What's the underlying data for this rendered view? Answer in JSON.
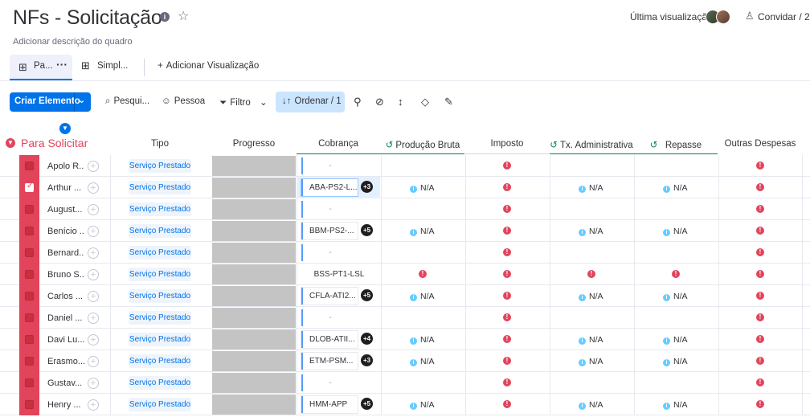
{
  "board": {
    "title": "NFs - Solicitação",
    "description": "Adicionar descrição do quadro",
    "last_view_label": "Última visualização",
    "invite_label": "Convidar / 2"
  },
  "views": {
    "tabs": [
      {
        "label": "Pa...",
        "icon": "table-icon",
        "active": true
      },
      {
        "label": "Simpl...",
        "icon": "table-icon",
        "active": false
      }
    ],
    "add_view_label": "Adicionar Visualização"
  },
  "toolbar": {
    "new_item_label": "Criar Elemento",
    "search_label": "Pesqui...",
    "person_label": "Pessoa",
    "filter_label": "Filtro",
    "sort_label": "Ordenar / 1"
  },
  "group": {
    "title": "Para Solicitar",
    "color": "#e2445c"
  },
  "columns": {
    "tipo": "Tipo",
    "progresso": "Progresso",
    "cobranca": "Cobrança",
    "producao": "Produção Bruta",
    "imposto": "Imposto",
    "tx_admin": "Tx. Administrativa",
    "repasse": "Repasse",
    "outras": "Outras Despesas"
  },
  "rows": [
    {
      "name": "Apolo R...",
      "checked": false,
      "tipo": "Serviço Prestado",
      "cobranca": "-",
      "cob_style": "dash",
      "badge": "",
      "producao": "",
      "imposto": "!",
      "tx_admin": "",
      "repasse": "",
      "outras": "!"
    },
    {
      "name": "Arthur ...",
      "checked": true,
      "tipo": "Serviço Prestado",
      "cobranca": "ABA-PS2-L...",
      "cob_style": "active",
      "badge": "+3",
      "producao": "N/A",
      "imposto": "!",
      "tx_admin": "N/A",
      "repasse": "N/A",
      "outras": "!"
    },
    {
      "name": "August...",
      "checked": false,
      "tipo": "Serviço Prestado",
      "cobranca": "-",
      "cob_style": "dash",
      "badge": "",
      "producao": "",
      "imposto": "!",
      "tx_admin": "",
      "repasse": "",
      "outras": "!"
    },
    {
      "name": "Benício ...",
      "checked": false,
      "tipo": "Serviço Prestado",
      "cobranca": "BBM-PS2-...",
      "cob_style": "normal",
      "badge": "+5",
      "producao": "N/A",
      "imposto": "!",
      "tx_admin": "N/A",
      "repasse": "N/A",
      "outras": "!"
    },
    {
      "name": "Bernard...",
      "checked": false,
      "tipo": "Serviço Prestado",
      "cobranca": "-",
      "cob_style": "dash",
      "badge": "",
      "producao": "",
      "imposto": "!",
      "tx_admin": "",
      "repasse": "",
      "outras": "!"
    },
    {
      "name": "Bruno S...",
      "checked": false,
      "tipo": "Serviço Prestado",
      "cobranca": "BSS-PT1-LSL",
      "cob_style": "plain",
      "badge": "",
      "producao": "!",
      "imposto": "!",
      "tx_admin": "!",
      "repasse": "!",
      "outras": "!"
    },
    {
      "name": "Carlos ...",
      "checked": false,
      "tipo": "Serviço Prestado",
      "cobranca": "CFLA-ATI2...",
      "cob_style": "normal",
      "badge": "+5",
      "producao": "N/A",
      "imposto": "!",
      "tx_admin": "N/A",
      "repasse": "N/A",
      "outras": "!"
    },
    {
      "name": "Daniel ...",
      "checked": false,
      "tipo": "Serviço Prestado",
      "cobranca": "-",
      "cob_style": "dash",
      "badge": "",
      "producao": "",
      "imposto": "!",
      "tx_admin": "",
      "repasse": "",
      "outras": "!"
    },
    {
      "name": "Davi Lu...",
      "checked": false,
      "tipo": "Serviço Prestado",
      "cobranca": "DLOB-ATII...",
      "cob_style": "normal",
      "badge": "+4",
      "producao": "N/A",
      "imposto": "!",
      "tx_admin": "N/A",
      "repasse": "N/A",
      "outras": "!"
    },
    {
      "name": "Erasmo...",
      "checked": false,
      "tipo": "Serviço Prestado",
      "cobranca": "ETM-PSM...",
      "cob_style": "normal",
      "badge": "+3",
      "producao": "N/A",
      "imposto": "!",
      "tx_admin": "N/A",
      "repasse": "N/A",
      "outras": "!"
    },
    {
      "name": "Gustav...",
      "checked": false,
      "tipo": "Serviço Prestado",
      "cobranca": "-",
      "cob_style": "dash",
      "badge": "",
      "producao": "",
      "imposto": "!",
      "tx_admin": "",
      "repasse": "",
      "outras": "!"
    },
    {
      "name": "Henry ...",
      "checked": false,
      "tipo": "Serviço Prestado",
      "cobranca": "HMM-APP",
      "cob_style": "normal",
      "badge": "+5",
      "producao": "N/A",
      "imposto": "!",
      "tx_admin": "N/A",
      "repasse": "N/A",
      "outras": "!"
    }
  ]
}
